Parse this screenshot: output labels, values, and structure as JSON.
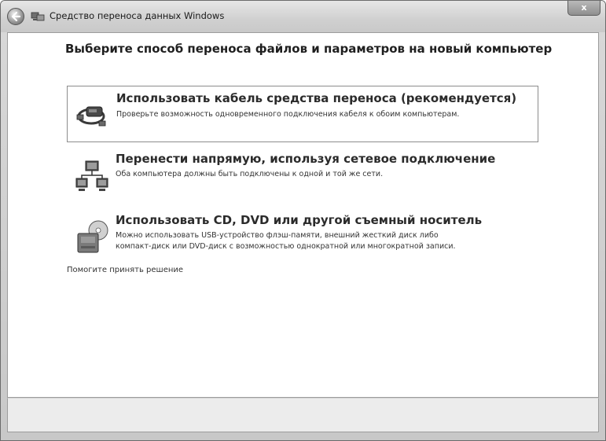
{
  "window": {
    "title": "Средство переноса данных Windows",
    "close_label": "x"
  },
  "main": {
    "heading": "Выберите способ переноса файлов и параметров на новый компьютер",
    "options": [
      {
        "title": "Использовать кабель средства переноса (рекомендуется)",
        "description": "Проверьте возможность одновременного подключения кабеля к обоим компьютерам.",
        "icon": "cable-icon",
        "selected": true
      },
      {
        "title": "Перенести напрямую, используя сетевое подключение",
        "description": "Оба компьютера должны быть подключены к одной и той же сети.",
        "icon": "network-computers-icon",
        "selected": false
      },
      {
        "title": "Использовать CD, DVD или другой съемный носитель",
        "description_line1": "Можно использовать USB-устройство флэш-памяти, внешний жесткий диск либо",
        "description_line2": "компакт-диск или DVD-диск с возможностью однократной или многократной записи.",
        "icon": "removable-media-icon",
        "selected": false
      }
    ],
    "help_link": "Помогите принять решение"
  }
}
